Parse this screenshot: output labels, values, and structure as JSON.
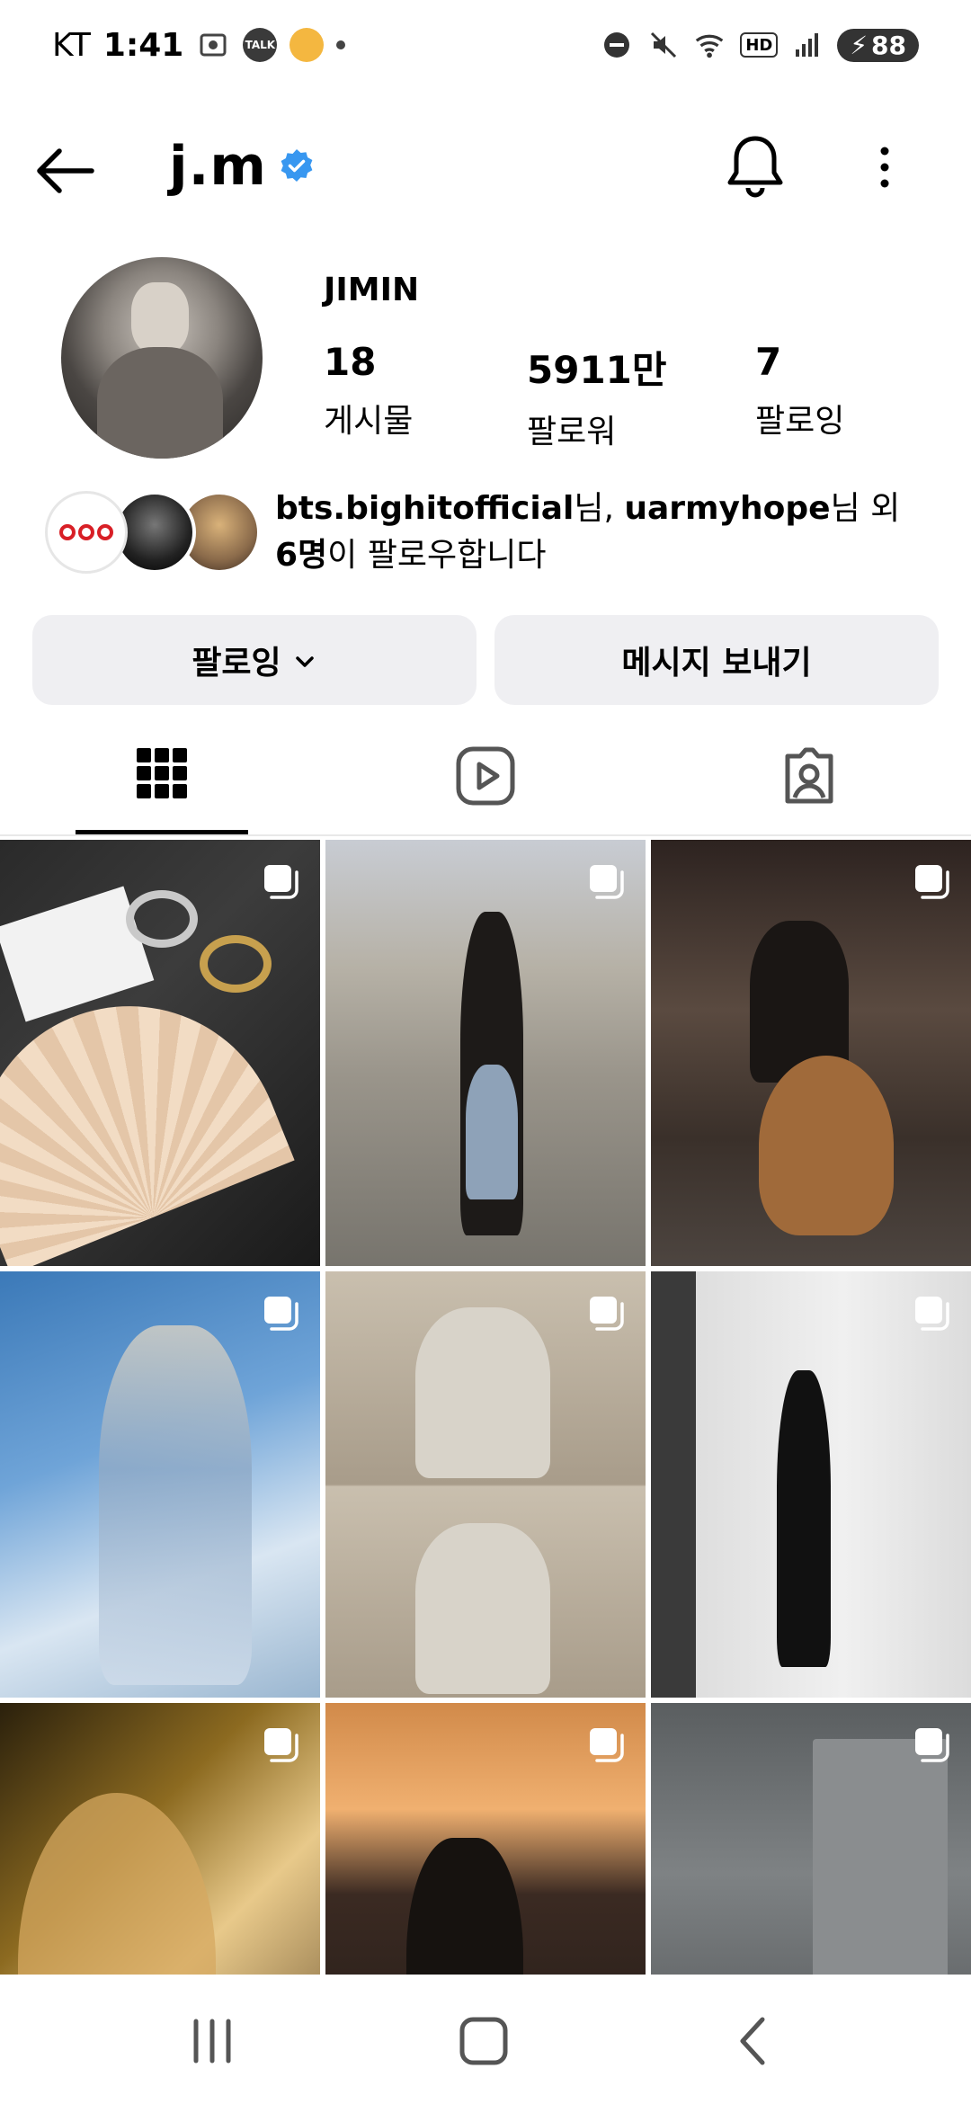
{
  "status_bar": {
    "carrier": "KT",
    "time": "1:41",
    "talk_label": "TALK",
    "battery": "88",
    "network": "5",
    "hd": "HD"
  },
  "header": {
    "username": "j.m"
  },
  "profile": {
    "display_name": "JIMIN",
    "stats": [
      {
        "value": "18",
        "label": "게시물"
      },
      {
        "value": "5911만",
        "label": "팔로워"
      },
      {
        "value": "7",
        "label": "팔로잉"
      }
    ]
  },
  "followed_by": {
    "user1": "bts.bighitofficial",
    "suffix1": "님, ",
    "user2": "uarmyhope",
    "suffix2": "님 외",
    "count": "6명",
    "suffix3": "이 팔로우합니다"
  },
  "actions": {
    "following_label": "팔로잉",
    "message_label": "메시지 보내기"
  },
  "tabs": [
    "grid-icon",
    "reels-icon",
    "tagged-icon"
  ],
  "grid": {
    "posts": [
      {
        "type": "carousel"
      },
      {
        "type": "carousel"
      },
      {
        "type": "carousel"
      },
      {
        "type": "carousel"
      },
      {
        "type": "carousel"
      },
      {
        "type": "carousel"
      },
      {
        "type": "carousel"
      },
      {
        "type": "carousel"
      },
      {
        "type": "carousel"
      }
    ]
  },
  "colors": {
    "verified": "#3897f0",
    "button_bg": "#efeff2"
  }
}
